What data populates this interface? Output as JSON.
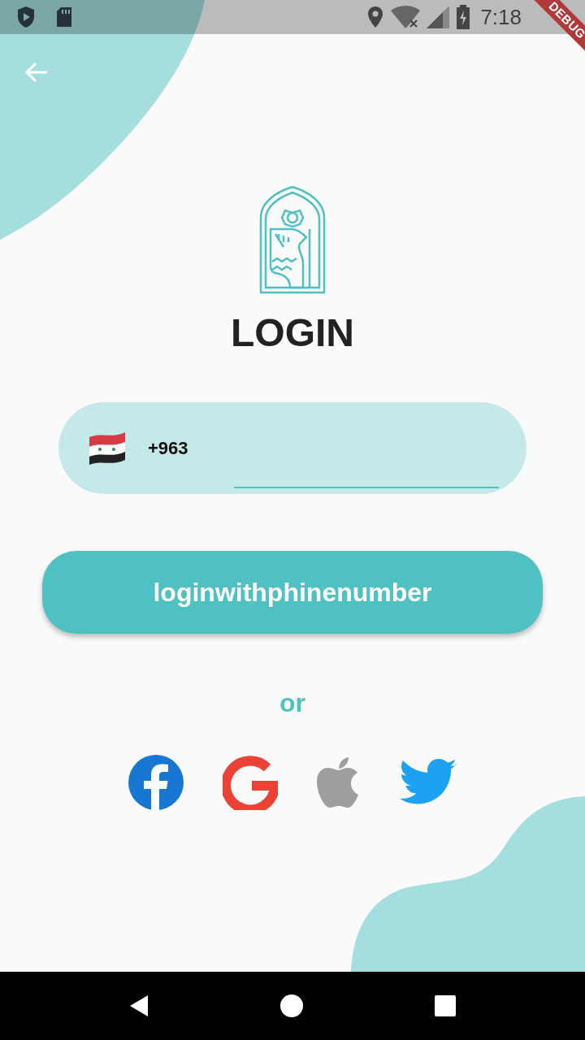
{
  "status_bar": {
    "time": "7:18"
  },
  "debug_banner": "DEBUG",
  "title": "LOGIN",
  "phone": {
    "country_code": "+963"
  },
  "submit_button": "loginwithphinenumber",
  "divider_text": "or",
  "social": [
    {
      "kind": "facebook"
    },
    {
      "kind": "google"
    },
    {
      "kind": "apple"
    },
    {
      "kind": "twitter"
    }
  ]
}
